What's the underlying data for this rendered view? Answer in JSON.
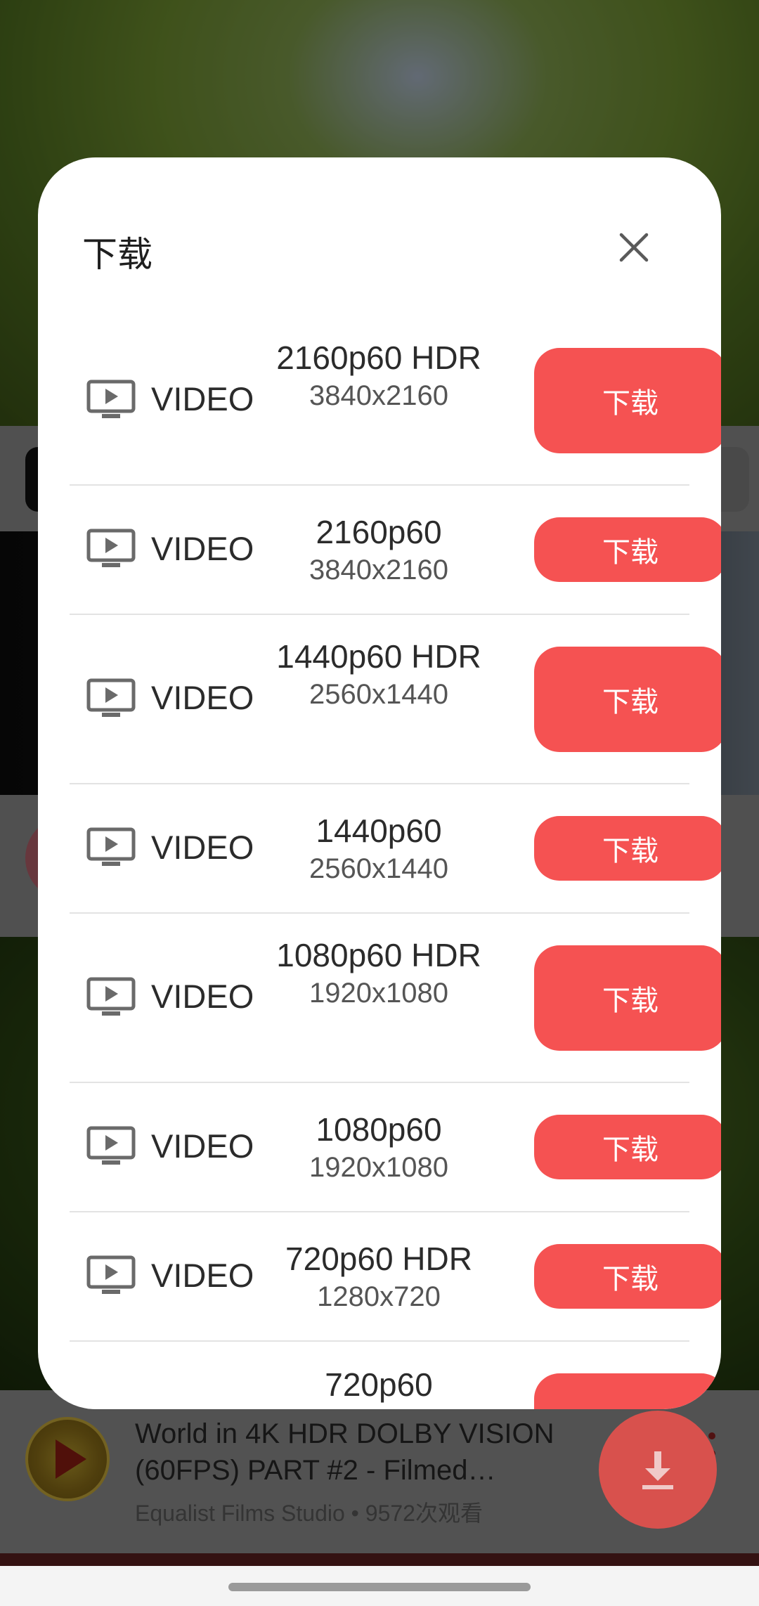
{
  "dialog": {
    "title": "下载",
    "close_icon": "close-icon",
    "items": [
      {
        "type": "VIDEO",
        "quality": "2160p60 HDR",
        "resolution": "3840x2160",
        "button": "下载"
      },
      {
        "type": "VIDEO",
        "quality": "2160p60",
        "resolution": "3840x2160",
        "button": "下载"
      },
      {
        "type": "VIDEO",
        "quality": "1440p60 HDR",
        "resolution": "2560x1440",
        "button": "下载"
      },
      {
        "type": "VIDEO",
        "quality": "1440p60",
        "resolution": "2560x1440",
        "button": "下载"
      },
      {
        "type": "VIDEO",
        "quality": "1080p60 HDR",
        "resolution": "1920x1080",
        "button": "下载"
      },
      {
        "type": "VIDEO",
        "quality": "1080p60",
        "resolution": "1920x1080",
        "button": "下载"
      },
      {
        "type": "VIDEO",
        "quality": "720p60 HDR",
        "resolution": "1280x720",
        "button": "下载"
      },
      {
        "type": "VIDEO",
        "quality": "720p60",
        "resolution": "",
        "button": ""
      }
    ]
  },
  "background_video": {
    "title_line1": "World in 4K HDR DOLBY VISION",
    "title_line2": "(60FPS) PART #2 - Filmed…",
    "channel": "Equalist Films Studio",
    "views": "9572次观看",
    "separator": "•"
  },
  "colors": {
    "accent": "#f55252",
    "fab": "#d8514d"
  }
}
